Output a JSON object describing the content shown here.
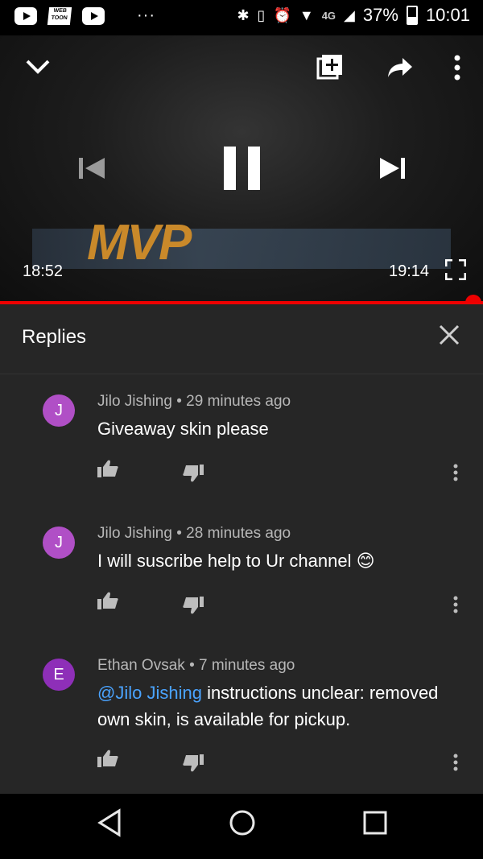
{
  "status_bar": {
    "battery": "37%",
    "time": "10:01",
    "network": "4G",
    "webtoon_label": "WEB TOON",
    "icons": [
      "youtube-icon",
      "webtoon-icon",
      "youtube-icon",
      "more-dots-icon",
      "bluetooth-icon",
      "vibrate-icon",
      "alarm-icon",
      "wifi-icon",
      "signal-icon",
      "battery-icon"
    ]
  },
  "player": {
    "current_time": "18:52",
    "end_time": "19:14",
    "progress_fraction": 0.964,
    "icons": {
      "collapse": "chevron-down-icon",
      "add_to_queue": "add-to-queue-icon",
      "share": "share-icon",
      "more": "more-vert-icon",
      "previous": "skip-previous-icon",
      "pause": "pause-icon",
      "next": "skip-next-icon",
      "fullscreen": "fullscreen-icon"
    }
  },
  "replies_panel": {
    "title": "Replies",
    "close_icon": "close-icon",
    "comments": [
      {
        "initial": "J",
        "author": "Jilo Jishing",
        "age": "29 minutes ago",
        "text": "Giveaway skin please",
        "avatar_color": "#b04fc6"
      },
      {
        "initial": "J",
        "author": "Jilo Jishing",
        "age": "28 minutes ago",
        "text": "I will suscribe help to Ur channel 😊",
        "avatar_color": "#b04fc6"
      },
      {
        "initial": "E",
        "author": "Ethan Ovsak",
        "age": "7 minutes ago",
        "mention": "@Jilo Jishing",
        "text": "instructions unclear: removed own skin, is available for pickup.",
        "avatar_color": "#8e2fb8"
      }
    ],
    "meta_separator": "•"
  },
  "nav_bar": {
    "back": "back-triangle-icon",
    "home": "home-circle-icon",
    "recents": "recents-square-icon"
  },
  "colors": {
    "accent": "#e00000",
    "mention": "#4aa3ff",
    "panel_bg": "#262626"
  }
}
